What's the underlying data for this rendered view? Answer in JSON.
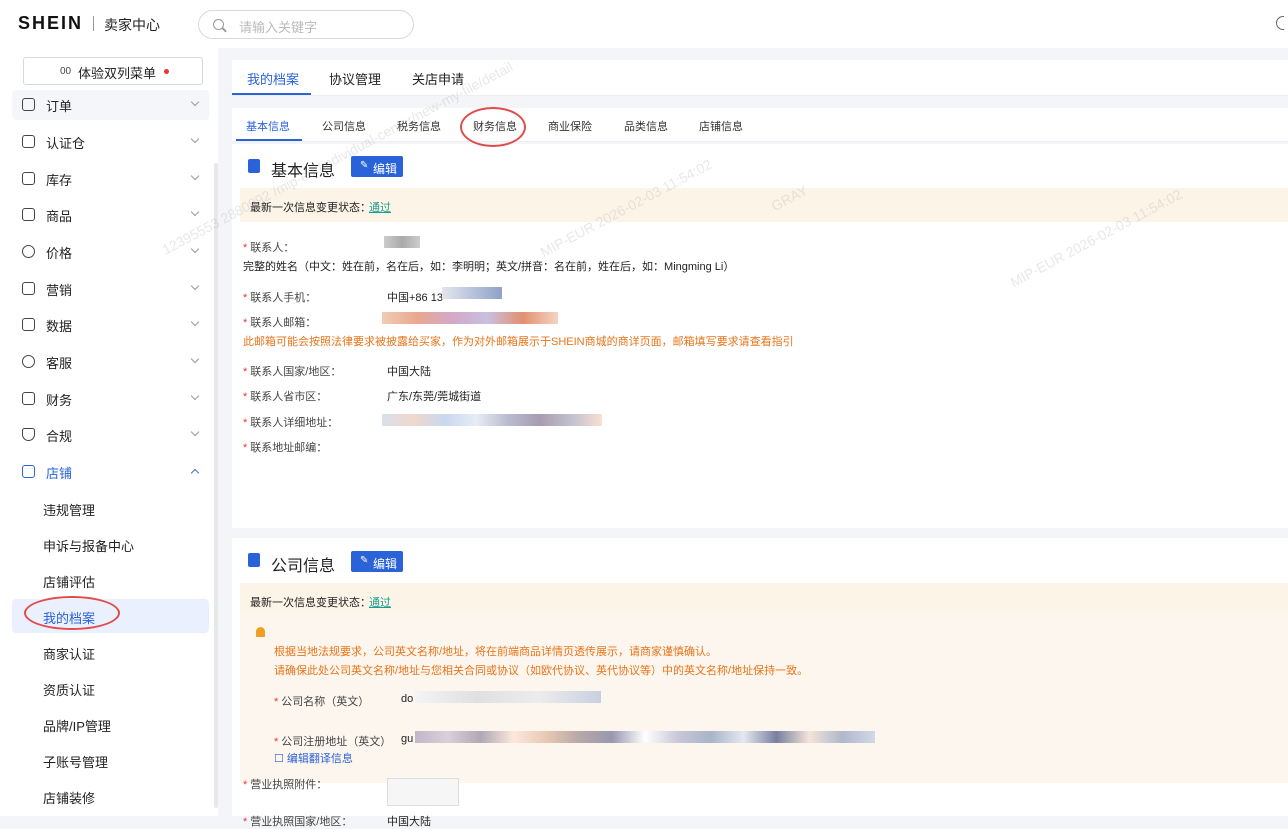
{
  "header": {
    "logo": "SHEIN",
    "subtitle": "卖家中心",
    "search_placeholder": "请输入关键字"
  },
  "sidebar": {
    "twocol_icon": "00",
    "twocol_label": "体验双列菜单",
    "menu": [
      {
        "label": "订单",
        "icon": "order-icon"
      },
      {
        "label": "认证仓",
        "icon": "warehouse-icon"
      },
      {
        "label": "库存",
        "icon": "inventory-icon"
      },
      {
        "label": "商品",
        "icon": "product-icon"
      },
      {
        "label": "价格",
        "icon": "price-icon"
      },
      {
        "label": "营销",
        "icon": "marketing-icon"
      },
      {
        "label": "数据",
        "icon": "data-icon"
      },
      {
        "label": "客服",
        "icon": "service-icon"
      },
      {
        "label": "财务",
        "icon": "finance-icon"
      },
      {
        "label": "合规",
        "icon": "compliance-icon"
      },
      {
        "label": "店铺",
        "icon": "store-icon"
      }
    ],
    "store_sub": [
      "违规管理",
      "申诉与报备中心",
      "店铺评估",
      "我的档案",
      "商家认证",
      "资质认证",
      "品牌/IP管理",
      "子账号管理",
      "店铺装修"
    ]
  },
  "tabs1": [
    "我的档案",
    "协议管理",
    "关店申请"
  ],
  "tabs2": [
    "基本信息",
    "公司信息",
    "税务信息",
    "财务信息",
    "商业保险",
    "品类信息",
    "店铺信息"
  ],
  "basic": {
    "title": "基本信息",
    "edit": "编辑",
    "status_label": "最新一次信息变更状态：",
    "status_value": "通过",
    "contact_label": "联系人：",
    "name_hint": "完整的姓名（中文：姓在前，名在后，如：李明明；英文/拼音：名在前，姓在后，如：Mingming Li）",
    "phone_label": "联系人手机：",
    "phone_value": "中国+86 13",
    "email_label": "联系人邮箱：",
    "email_hint": "此邮箱可能会按照法律要求被披露给买家，作为对外邮箱展示于SHEIN商城的商详页面，邮箱填写要求请查看指引",
    "country_label": "联系人国家/地区：",
    "country_value": "中国大陆",
    "province_label": "联系人省市区：",
    "province_value": "广东/东莞/莞城街道",
    "address_label": "联系人详细地址：",
    "zip_label": "联系地址邮编："
  },
  "company": {
    "title": "公司信息",
    "edit": "编辑",
    "status_label": "最新一次信息变更状态：",
    "status_value": "通过",
    "notice_line1": "根据当地法规要求，公司英文名称/地址，将在前端商品详情页透传展示，请商家谨慎确认。",
    "notice_line2": "请确保此处公司英文名称/地址与您相关合同或协议（如欧代协议、英代协议等）中的英文名称/地址保持一致。",
    "name_en_label": "公司名称（英文）",
    "name_en_value": "do",
    "addr_en_label": "公司注册地址（英文）",
    "addr_en_value": "gu",
    "edit_translation": "编辑翻译信息",
    "license_country_label": "营业执照国家/地区：",
    "license_country_value": "中国大陆",
    "license_attachment_label": "营业执照附件："
  },
  "watermark": {
    "line1": "12395553 2880992 /mip-eur/individual-center/new-my-file/detail",
    "line2": "MIP-EUR 2026-02-03 11:54:02",
    "line3": "GRAY"
  },
  "colors": {
    "accent": "#2a63d8",
    "status_green": "#1a9e8e",
    "warning_orange": "#e8741a",
    "highlight_red": "#e04c4c"
  }
}
